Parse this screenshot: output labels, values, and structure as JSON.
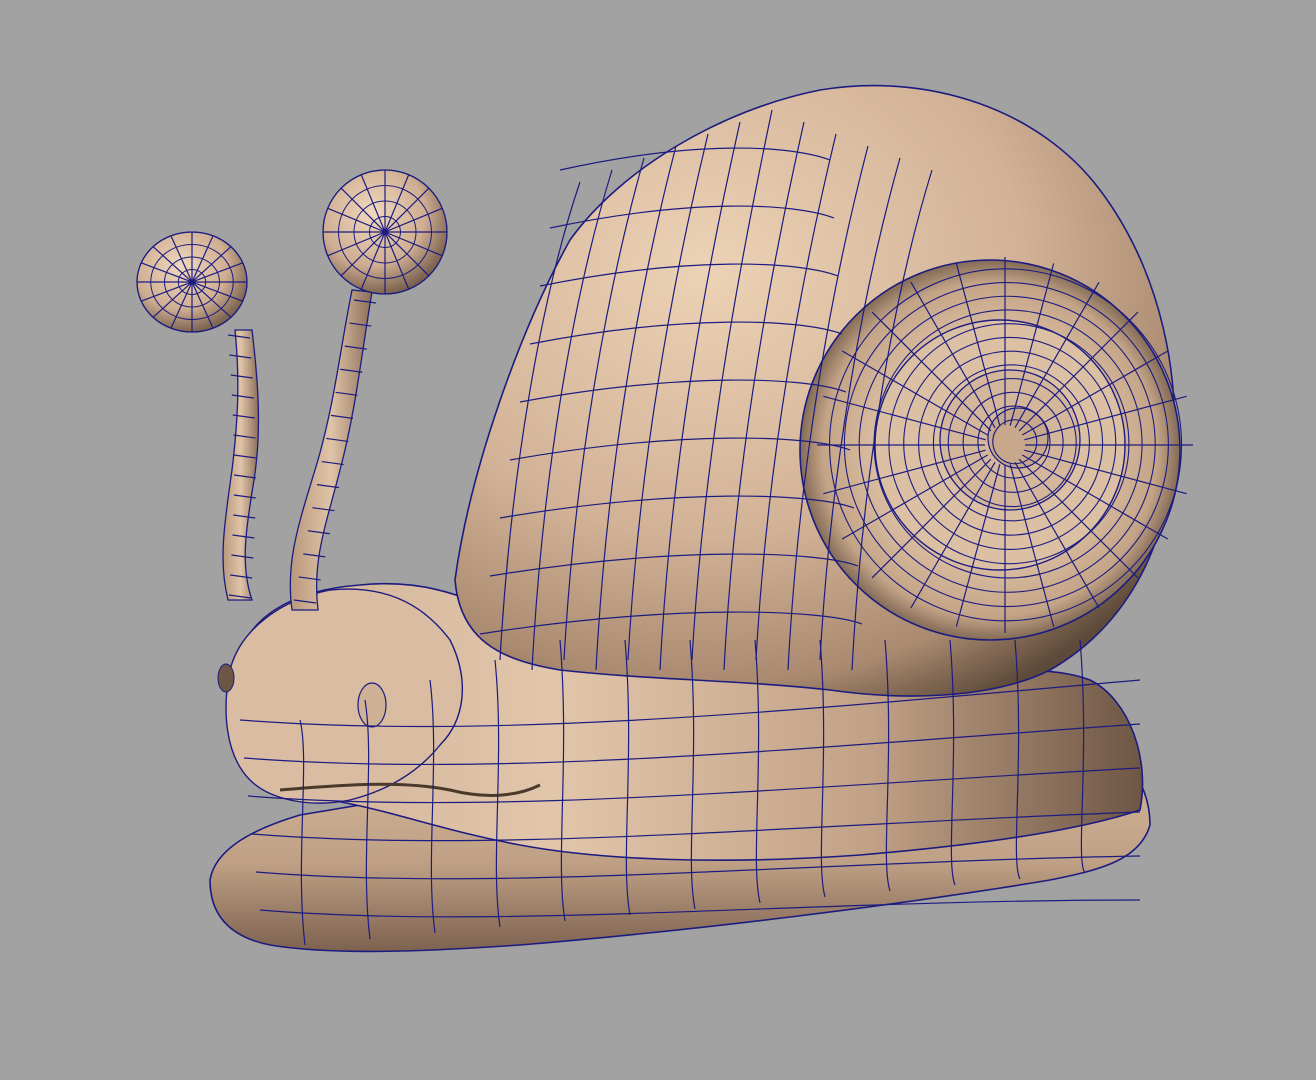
{
  "viewport": {
    "background": "#a2a2a2",
    "shading": "smooth-shaded",
    "wireframe_overlay": true
  },
  "model": {
    "subject": "cartoon snail",
    "parts": [
      "shell",
      "shell-spiral",
      "body",
      "head",
      "left-eye-stalk",
      "right-eye-stalk",
      "mouth",
      "nostril"
    ]
  },
  "colors": {
    "surface": "#c8a88c",
    "surface_light": "#e0c4a8",
    "surface_shadow": "#5a4636",
    "wire": "#1c1c80"
  }
}
